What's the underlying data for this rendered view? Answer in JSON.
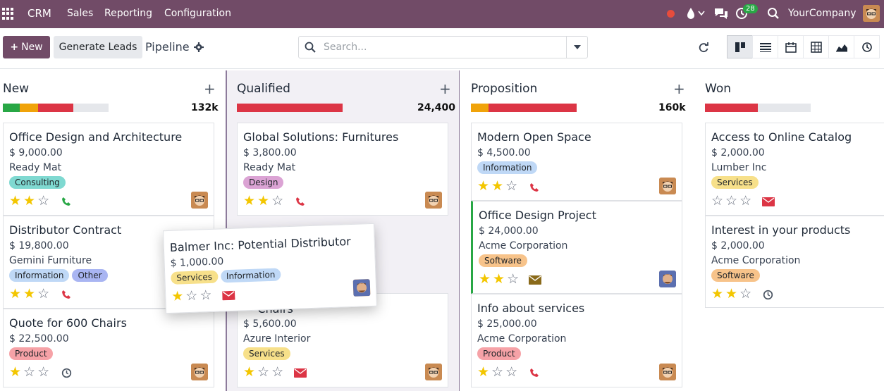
{
  "navbar": {
    "brand": "CRM",
    "menu": [
      "Sales",
      "Reporting",
      "Configuration"
    ],
    "activity_count": "28",
    "company": "YourCompany"
  },
  "controls": {
    "new_label": "New",
    "generate_label": "Generate Leads",
    "breadcrumb": "Pipeline",
    "search_placeholder": "Search..."
  },
  "columns": [
    {
      "title": "New",
      "total": "132k",
      "cards": [
        {
          "title": "Office Design and Architecture",
          "amount": "$ 9,000.00",
          "company": "Ready Mat",
          "tags": [
            "Consulting"
          ],
          "stars": 2,
          "activity": "phone"
        },
        {
          "title": "Distributor Contract",
          "amount": "$ 19,800.00",
          "company": "Gemini Furniture",
          "tags": [
            "Information",
            "Other"
          ],
          "stars": 2,
          "activity": "phone"
        },
        {
          "title": "Quote for 600 Chairs",
          "amount": "$ 22,500.00",
          "company": "",
          "tags": [
            "Product"
          ],
          "stars": 1,
          "activity": "clock"
        }
      ]
    },
    {
      "title": "Qualified",
      "total": "24,400",
      "cards": [
        {
          "title": "Global Solutions: Furnitures",
          "amount": "$ 3,800.00",
          "company": "Ready Mat",
          "tags": [
            "Design"
          ],
          "stars": 2,
          "activity": "phone"
        },
        {
          "title": "··· Chairs",
          "amount": "$ 5,600.00",
          "company": "Azure Interior",
          "tags": [
            "Services"
          ],
          "stars": 1,
          "activity": "mail"
        }
      ]
    },
    {
      "title": "Proposition",
      "total": "160k",
      "cards": [
        {
          "title": "Modern Open Space",
          "amount": "$ 4,500.00",
          "company": "",
          "tags": [
            "Information"
          ],
          "stars": 2,
          "activity": "phone"
        },
        {
          "title": "Office Design Project",
          "amount": "$ 24,000.00",
          "company": "Acme Corporation",
          "tags": [
            "Software"
          ],
          "stars": 2,
          "activity": "mail-dark"
        },
        {
          "title": "Info about services",
          "amount": "$ 25,000.00",
          "company": "Acme Corporation",
          "tags": [
            "Product"
          ],
          "stars": 1,
          "activity": "phone"
        }
      ]
    },
    {
      "title": "Won",
      "total": "",
      "cards": [
        {
          "title": "Access to Online Catalog",
          "amount": "$ 2,000.00",
          "company": "Lumber Inc",
          "tags": [
            "Services"
          ],
          "stars": 0,
          "activity": "mail"
        },
        {
          "title": "Interest in your products",
          "amount": "$ 2,000.00",
          "company": "Acme Corporation",
          "tags": [
            "Software"
          ],
          "stars": 2,
          "activity": "clock"
        }
      ]
    }
  ],
  "dragged_card": {
    "title": "Balmer Inc: Potential Distributor",
    "amount": "$ 1,000.00",
    "tags": [
      "Services",
      "Information"
    ],
    "stars": 1,
    "activity": "mail"
  },
  "colors": {
    "brand": "#714b67",
    "green": "#28a745",
    "orange": "#f0a30a",
    "red": "#dc3545"
  }
}
